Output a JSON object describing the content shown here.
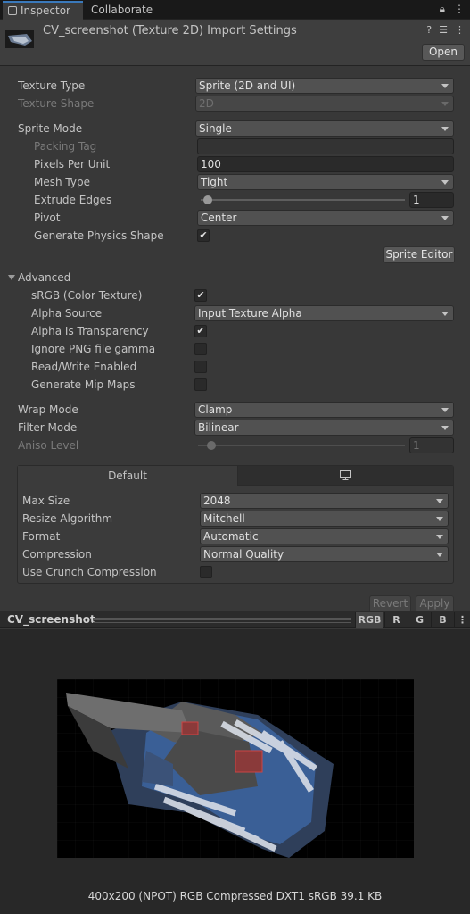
{
  "tabs": [
    {
      "label": "Inspector",
      "active": true
    },
    {
      "label": "Collaborate",
      "active": false
    }
  ],
  "tab_icons": {
    "lock": "lock-icon",
    "menu": "kebab-menu-icon"
  },
  "header": {
    "title": "CV_screenshot (Texture 2D) Import Settings",
    "open_label": "Open",
    "icons": [
      "help-icon",
      "preset-icon",
      "kebab-menu-icon"
    ]
  },
  "texture": {
    "type_label": "Texture Type",
    "type_value": "Sprite (2D and UI)",
    "shape_label": "Texture Shape",
    "shape_value": "2D"
  },
  "sprite": {
    "mode_label": "Sprite Mode",
    "mode_value": "Single",
    "packing_tag_label": "Packing Tag",
    "packing_tag_value": "",
    "ppu_label": "Pixels Per Unit",
    "ppu_value": "100",
    "mesh_type_label": "Mesh Type",
    "mesh_type_value": "Tight",
    "extrude_label": "Extrude Edges",
    "extrude_value": "1",
    "extrude_fraction": 0.03,
    "pivot_label": "Pivot",
    "pivot_value": "Center",
    "physics_label": "Generate Physics Shape",
    "physics_checked": true,
    "editor_button": "Sprite Editor"
  },
  "advanced": {
    "label": "Advanced",
    "srgb_label": "sRGB (Color Texture)",
    "srgb_checked": true,
    "alpha_source_label": "Alpha Source",
    "alpha_source_value": "Input Texture Alpha",
    "alpha_transparency_label": "Alpha Is Transparency",
    "alpha_transparency_checked": true,
    "ignore_png_label": "Ignore PNG file gamma",
    "ignore_png_checked": false,
    "read_write_label": "Read/Write Enabled",
    "read_write_checked": false,
    "mipmaps_label": "Generate Mip Maps",
    "mipmaps_checked": false
  },
  "sampling": {
    "wrap_label": "Wrap Mode",
    "wrap_value": "Clamp",
    "filter_label": "Filter Mode",
    "filter_value": "Bilinear",
    "aniso_label": "Aniso Level",
    "aniso_value": "1"
  },
  "platform": {
    "tab_default": "Default",
    "tab_standalone_icon": "monitor-icon",
    "max_size_label": "Max Size",
    "max_size_value": "2048",
    "resize_label": "Resize Algorithm",
    "resize_value": "Mitchell",
    "format_label": "Format",
    "format_value": "Automatic",
    "compression_label": "Compression",
    "compression_value": "Normal Quality",
    "crunch_label": "Use Crunch Compression",
    "crunch_checked": false
  },
  "actions": {
    "revert": "Revert",
    "apply": "Apply"
  },
  "preview": {
    "title": "CV_screenshot",
    "channels": [
      "RGB",
      "R",
      "G",
      "B"
    ],
    "active_channel": "RGB",
    "info": "400x200 (NPOT)  RGB Compressed DXT1 sRGB   39.1 KB"
  }
}
